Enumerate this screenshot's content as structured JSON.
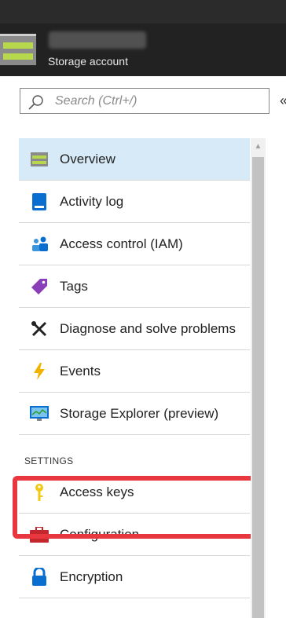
{
  "header": {
    "resource_type": "Storage account"
  },
  "search": {
    "placeholder": "Search (Ctrl+/)"
  },
  "menu": {
    "items": [
      {
        "label": "Overview",
        "icon": "storage-icon"
      },
      {
        "label": "Activity log",
        "icon": "activity-log-icon"
      },
      {
        "label": "Access control (IAM)",
        "icon": "people-icon"
      },
      {
        "label": "Tags",
        "icon": "tag-icon"
      },
      {
        "label": "Diagnose and solve problems",
        "icon": "tools-icon"
      },
      {
        "label": "Events",
        "icon": "lightning-icon"
      },
      {
        "label": "Storage Explorer (preview)",
        "icon": "monitor-icon"
      }
    ],
    "settings_header": "SETTINGS",
    "settings_items": [
      {
        "label": "Access keys",
        "icon": "key-icon"
      },
      {
        "label": "Configuration",
        "icon": "toolbox-icon"
      },
      {
        "label": "Encryption",
        "icon": "lock-icon"
      }
    ]
  },
  "colors": {
    "selected_bg": "#d6eaf8",
    "highlight": "#e8373f",
    "header_bg": "#222222"
  }
}
